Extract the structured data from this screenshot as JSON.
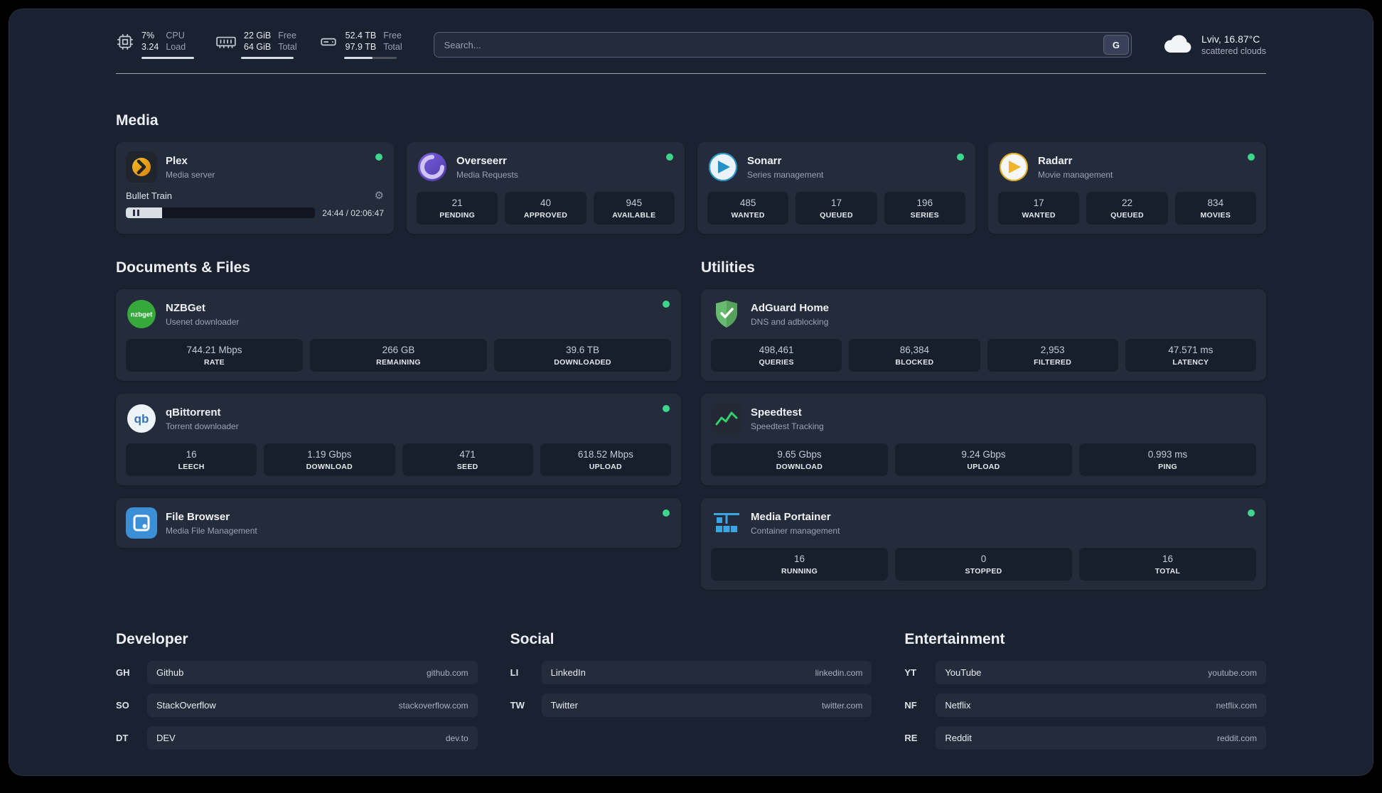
{
  "topbar": {
    "cpu": {
      "values": [
        "7%",
        "3.24"
      ],
      "labels": [
        "CPU",
        "Load"
      ],
      "bar_percent": 100
    },
    "memory": {
      "values": [
        "22 GiB",
        "64 GiB"
      ],
      "labels": [
        "Free",
        "Total"
      ],
      "bar_percent": 100
    },
    "disk": {
      "values": [
        "52.4 TB",
        "97.9 TB"
      ],
      "labels": [
        "Free",
        "Total"
      ],
      "bar_percent": 54
    },
    "search": {
      "placeholder": "Search...",
      "button_label": "G"
    },
    "weather": {
      "location": "Lviv, 16.87°C",
      "condition": "scattered clouds"
    }
  },
  "media": {
    "title": "Media",
    "plex": {
      "name": "Plex",
      "subtitle": "Media server",
      "player": {
        "track": "Bullet Train",
        "time": "24:44 / 02:06:47",
        "progress_percent": 19
      }
    },
    "overseerr": {
      "name": "Overseerr",
      "subtitle": "Media Requests",
      "stats": [
        {
          "value": "21",
          "label": "PENDING"
        },
        {
          "value": "40",
          "label": "APPROVED"
        },
        {
          "value": "945",
          "label": "AVAILABLE"
        }
      ]
    },
    "sonarr": {
      "name": "Sonarr",
      "subtitle": "Series management",
      "stats": [
        {
          "value": "485",
          "label": "WANTED"
        },
        {
          "value": "17",
          "label": "QUEUED"
        },
        {
          "value": "196",
          "label": "SERIES"
        }
      ]
    },
    "radarr": {
      "name": "Radarr",
      "subtitle": "Movie management",
      "stats": [
        {
          "value": "17",
          "label": "WANTED"
        },
        {
          "value": "22",
          "label": "QUEUED"
        },
        {
          "value": "834",
          "label": "MOVIES"
        }
      ]
    }
  },
  "documents": {
    "title": "Documents & Files",
    "nzbget": {
      "name": "NZBGet",
      "subtitle": "Usenet downloader",
      "stats": [
        {
          "value": "744.21 Mbps",
          "label": "RATE"
        },
        {
          "value": "266 GB",
          "label": "REMAINING"
        },
        {
          "value": "39.6 TB",
          "label": "DOWNLOADED"
        }
      ]
    },
    "qbittorrent": {
      "name": "qBittorrent",
      "subtitle": "Torrent downloader",
      "stats": [
        {
          "value": "16",
          "label": "LEECH"
        },
        {
          "value": "1.19 Gbps",
          "label": "DOWNLOAD"
        },
        {
          "value": "471",
          "label": "SEED"
        },
        {
          "value": "618.52 Mbps",
          "label": "UPLOAD"
        }
      ]
    },
    "filebrowser": {
      "name": "File Browser",
      "subtitle": "Media File Management"
    }
  },
  "utilities": {
    "title": "Utilities",
    "adguard": {
      "name": "AdGuard Home",
      "subtitle": "DNS and adblocking",
      "stats": [
        {
          "value": "498,461",
          "label": "QUERIES"
        },
        {
          "value": "86,384",
          "label": "BLOCKED"
        },
        {
          "value": "2,953",
          "label": "FILTERED"
        },
        {
          "value": "47.571 ms",
          "label": "LATENCY"
        }
      ]
    },
    "speedtest": {
      "name": "Speedtest",
      "subtitle": "Speedtest Tracking",
      "stats": [
        {
          "value": "9.65 Gbps",
          "label": "DOWNLOAD"
        },
        {
          "value": "9.24 Gbps",
          "label": "UPLOAD"
        },
        {
          "value": "0.993 ms",
          "label": "PING"
        }
      ]
    },
    "portainer": {
      "name": "Media Portainer",
      "subtitle": "Container management",
      "stats": [
        {
          "value": "16",
          "label": "RUNNING"
        },
        {
          "value": "0",
          "label": "STOPPED"
        },
        {
          "value": "16",
          "label": "TOTAL"
        }
      ]
    }
  },
  "bookmarks": {
    "developer": {
      "title": "Developer",
      "items": [
        {
          "abbr": "GH",
          "name": "Github",
          "url": "github.com"
        },
        {
          "abbr": "SO",
          "name": "StackOverflow",
          "url": "stackoverflow.com"
        },
        {
          "abbr": "DT",
          "name": "DEV",
          "url": "dev.to"
        }
      ]
    },
    "social": {
      "title": "Social",
      "items": [
        {
          "abbr": "LI",
          "name": "LinkedIn",
          "url": "linkedin.com"
        },
        {
          "abbr": "TW",
          "name": "Twitter",
          "url": "twitter.com"
        }
      ]
    },
    "entertainment": {
      "title": "Entertainment",
      "items": [
        {
          "abbr": "YT",
          "name": "YouTube",
          "url": "youtube.com"
        },
        {
          "abbr": "NF",
          "name": "Netflix",
          "url": "netflix.com"
        },
        {
          "abbr": "RE",
          "name": "Reddit",
          "url": "reddit.com"
        }
      ]
    }
  }
}
